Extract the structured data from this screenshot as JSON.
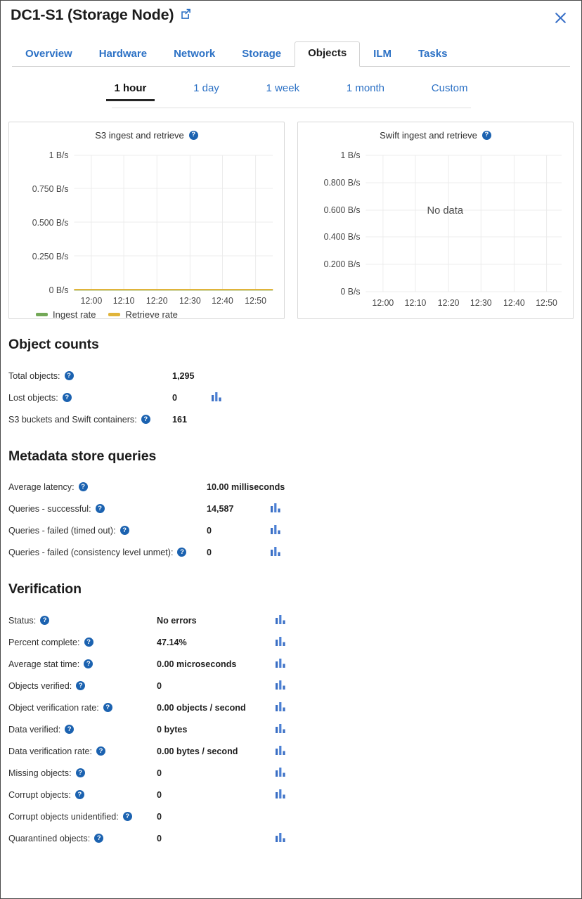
{
  "header": {
    "title": "DC1-S1 (Storage Node)",
    "external_link_icon": "external-link-icon",
    "close_icon": "close-icon"
  },
  "node_tabs": [
    {
      "label": "Overview",
      "active": false
    },
    {
      "label": "Hardware",
      "active": false
    },
    {
      "label": "Network",
      "active": false
    },
    {
      "label": "Storage",
      "active": false
    },
    {
      "label": "Objects",
      "active": true
    },
    {
      "label": "ILM",
      "active": false
    },
    {
      "label": "Tasks",
      "active": false
    }
  ],
  "range_tabs": [
    {
      "label": "1 hour",
      "active": true
    },
    {
      "label": "1 day",
      "active": false
    },
    {
      "label": "1 week",
      "active": false
    },
    {
      "label": "1 month",
      "active": false
    },
    {
      "label": "Custom",
      "active": false
    }
  ],
  "charts": [
    {
      "title": "S3 ingest and retrieve",
      "help": "?",
      "legend": [
        {
          "label": "Ingest rate",
          "color": "#73a857"
        },
        {
          "label": "Retrieve rate",
          "color": "#e0b43a"
        }
      ]
    },
    {
      "title": "Swift ingest and retrieve",
      "help": "?",
      "empty_message": "No data",
      "legend": []
    }
  ],
  "chart_data": [
    {
      "type": "line",
      "title": "S3 ingest and retrieve",
      "xlabel": "",
      "ylabel": "",
      "ytick_labels": [
        "1 B/s",
        "0.750 B/s",
        "0.500 B/s",
        "0.250 B/s",
        "0 B/s"
      ],
      "ytick_values": [
        1,
        0.75,
        0.5,
        0.25,
        0
      ],
      "ylim": [
        0,
        1
      ],
      "xtick_labels": [
        "12:00",
        "12:10",
        "12:20",
        "12:30",
        "12:40",
        "12:50"
      ],
      "grid": true,
      "legend_position": "bottom-left",
      "series": [
        {
          "name": "Ingest rate",
          "color": "#73a857",
          "values": [
            0,
            0,
            0,
            0,
            0,
            0
          ]
        },
        {
          "name": "Retrieve rate",
          "color": "#e0b43a",
          "values": [
            0,
            0,
            0,
            0,
            0,
            0
          ]
        }
      ]
    },
    {
      "type": "line",
      "title": "Swift ingest and retrieve",
      "xlabel": "",
      "ylabel": "",
      "ytick_labels": [
        "1 B/s",
        "0.800 B/s",
        "0.600 B/s",
        "0.400 B/s",
        "0.200 B/s",
        "0 B/s"
      ],
      "ytick_values": [
        1,
        0.8,
        0.6,
        0.4,
        0.2,
        0
      ],
      "ylim": [
        0,
        1
      ],
      "xtick_labels": [
        "12:00",
        "12:10",
        "12:20",
        "12:30",
        "12:40",
        "12:50"
      ],
      "grid": true,
      "annotation": "No data",
      "series": []
    }
  ],
  "object_counts": {
    "title": "Object counts",
    "rows": [
      {
        "label": "Total objects:",
        "value": "1,295",
        "has_chart_icon": false
      },
      {
        "label": "Lost objects:",
        "value": "0",
        "has_chart_icon": true
      },
      {
        "label": "S3 buckets and Swift containers:",
        "value": "161",
        "has_chart_icon": false
      }
    ]
  },
  "metadata_store_queries": {
    "title": "Metadata store queries",
    "rows": [
      {
        "label": "Average latency:",
        "value": "10.00 milliseconds",
        "has_chart_icon": false
      },
      {
        "label": "Queries - successful:",
        "value": "14,587",
        "has_chart_icon": true
      },
      {
        "label": "Queries - failed (timed out):",
        "value": "0",
        "has_chart_icon": true
      },
      {
        "label": "Queries - failed (consistency level unmet):",
        "value": "0",
        "has_chart_icon": true
      }
    ]
  },
  "verification": {
    "title": "Verification",
    "rows": [
      {
        "label": "Status:",
        "value": "No errors",
        "has_chart_icon": true
      },
      {
        "label": "Percent complete:",
        "value": "47.14%",
        "has_chart_icon": true
      },
      {
        "label": "Average stat time:",
        "value": "0.00 microseconds",
        "has_chart_icon": true
      },
      {
        "label": "Objects verified:",
        "value": "0",
        "has_chart_icon": true
      },
      {
        "label": "Object verification rate:",
        "value": "0.00 objects / second",
        "has_chart_icon": true
      },
      {
        "label": "Data verified:",
        "value": "0 bytes",
        "has_chart_icon": true
      },
      {
        "label": "Data verification rate:",
        "value": "0.00 bytes / second",
        "has_chart_icon": true
      },
      {
        "label": "Missing objects:",
        "value": "0",
        "has_chart_icon": true
      },
      {
        "label": "Corrupt objects:",
        "value": "0",
        "has_chart_icon": true
      },
      {
        "label": "Corrupt objects unidentified:",
        "value": "0",
        "has_chart_icon": false
      },
      {
        "label": "Quarantined objects:",
        "value": "0",
        "has_chart_icon": true
      }
    ]
  },
  "icons": {
    "help": "help-icon",
    "bar_chart": "bar-chart-icon"
  },
  "colors": {
    "link": "#2c71c5",
    "accent_blue": "#1b62b0",
    "chart_icon_blue": "#3b6fc4",
    "ingest": "#73a857",
    "retrieve": "#e0b43a"
  }
}
